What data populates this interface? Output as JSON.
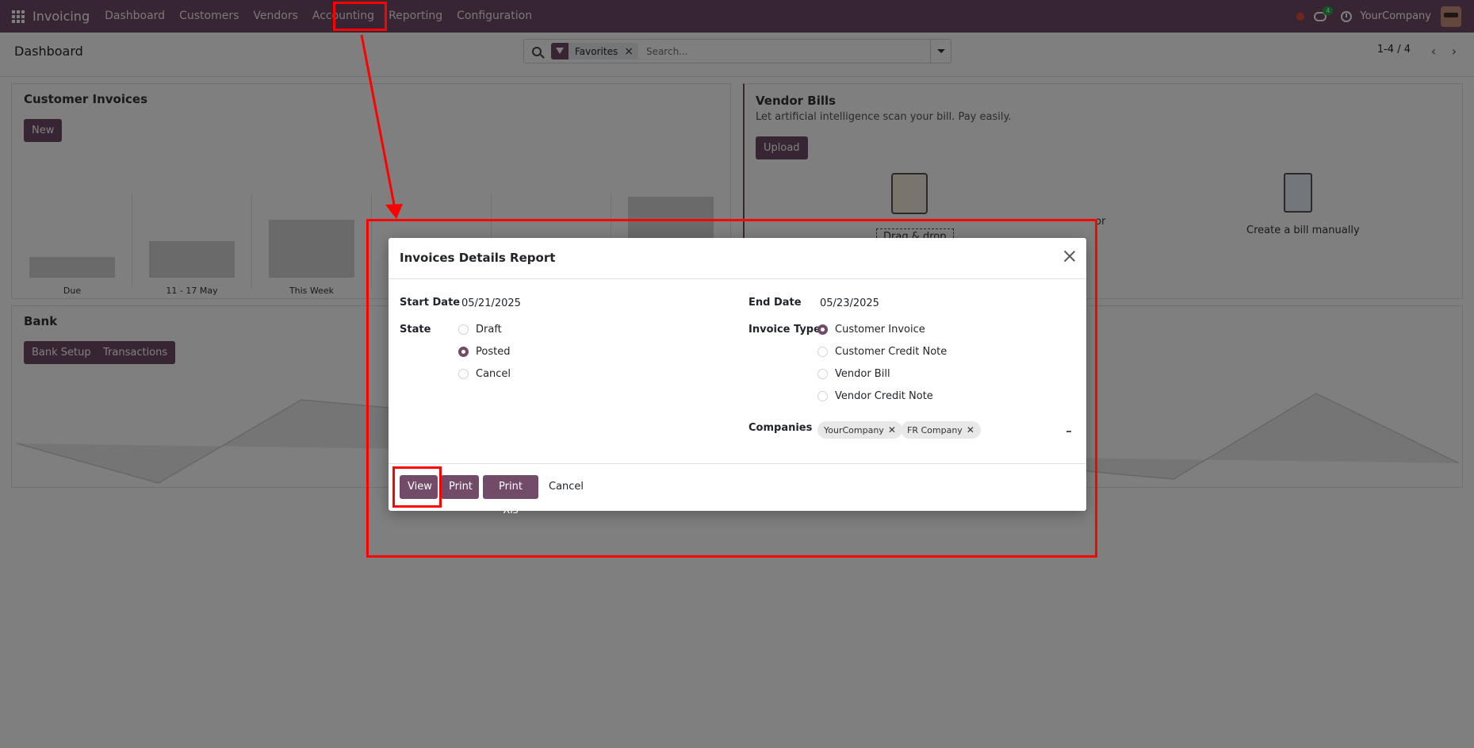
{
  "topbar": {
    "brand": "Invoicing",
    "menu": [
      "Dashboard",
      "Customers",
      "Vendors",
      "Accounting",
      "Reporting",
      "Configuration"
    ],
    "chat_badge": "4",
    "company": "YourCompany",
    "accent": "#714b67"
  },
  "control": {
    "breadcrumb": "Dashboard",
    "facet": "Favorites",
    "search_placeholder": "Search...",
    "pager": "1-4 / 4"
  },
  "customer_invoices": {
    "title": "Customer Invoices",
    "new_label": "New",
    "labels": [
      "Due",
      "11 - 17 May",
      "This Week"
    ]
  },
  "vendor_bills": {
    "title": "Vendor Bills",
    "subtitle": "Let artificial intelligence scan your bill. Pay easily.",
    "upload_label": "Upload",
    "drag_drop": "Drag & drop",
    "partial_text": "or",
    "manual": "Create a bill manually"
  },
  "bank": {
    "title": "Bank",
    "setup_label": "Bank Setup",
    "transactions_label": "Transactions"
  },
  "modal": {
    "title": "Invoices Details Report",
    "start_date_label": "Start Date",
    "start_date": "05/21/2025",
    "end_date_label": "End Date",
    "end_date": "05/23/2025",
    "state_label": "State",
    "states": [
      "Draft",
      "Posted",
      "Cancel"
    ],
    "selected_state": "Posted",
    "invoice_type_label": "Invoice Type",
    "invoice_types": [
      "Customer Invoice",
      "Customer Credit Note",
      "Vendor Bill",
      "Vendor Credit Note"
    ],
    "selected_invoice_type": "Customer Invoice",
    "companies_label": "Companies",
    "companies": [
      "YourCompany",
      "FR Company"
    ],
    "buttons": {
      "view": "View",
      "print": "Print",
      "print_xls": "Print Xls",
      "cancel": "Cancel"
    }
  },
  "annotation_color": "#ff0000"
}
